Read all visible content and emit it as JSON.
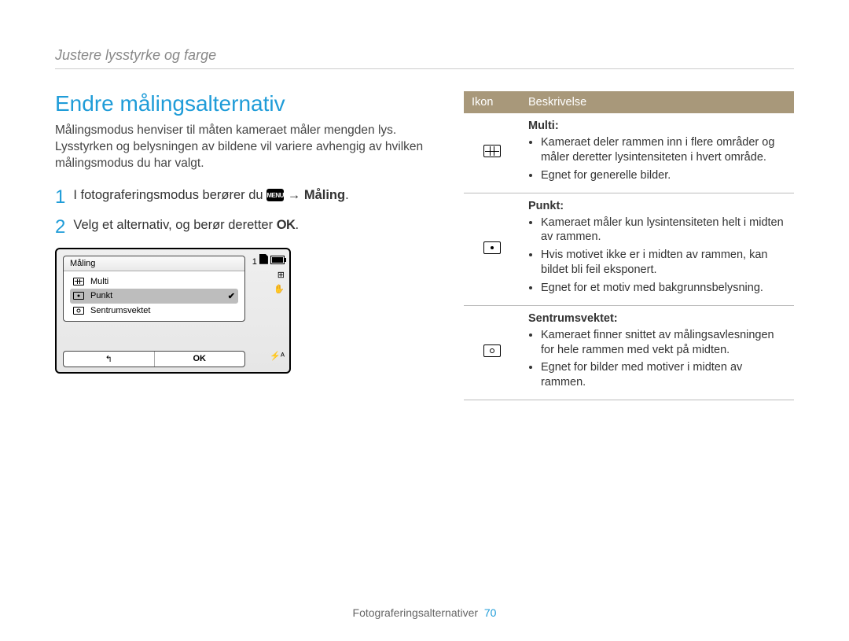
{
  "breadcrumb": "Justere lysstyrke og farge",
  "title": "Endre målingsalternativ",
  "intro": "Målingsmodus henviser til måten kameraet måler mengden lys. Lysstyrken og belysningen av bildene vil variere avhengig av hvilken målingsmodus du har valgt.",
  "steps": {
    "s1_num": "1",
    "s1_pre": "I fotograferingsmodus berører du ",
    "s1_post": " → ",
    "s1_bold": "Måling",
    "s1_end": ".",
    "s2_num": "2",
    "s2_text": "Velg et alternativ, og berør deretter ",
    "s2_ok": "OK",
    "s2_end": "."
  },
  "menu_chip": "MENU",
  "camera_ui": {
    "panel_title": "Måling",
    "items": [
      {
        "label": "Multi",
        "selected": false
      },
      {
        "label": "Punkt",
        "selected": true
      },
      {
        "label": "Sentrumsvektet",
        "selected": false
      }
    ],
    "back_glyph": "↰",
    "ok_label": "OK",
    "status_count": "1",
    "flash": "⚡ᴬ"
  },
  "table": {
    "head_icon": "Ikon",
    "head_desc": "Beskrivelse",
    "rows": [
      {
        "icon": "multi",
        "title": "Multi:",
        "bullets": [
          "Kameraet deler rammen inn i flere områder og måler deretter lysintensiteten i hvert område.",
          "Egnet for generelle bilder."
        ]
      },
      {
        "icon": "spot",
        "title": "Punkt:",
        "bullets": [
          "Kameraet måler kun lysintensiteten helt i midten av rammen.",
          "Hvis motivet ikke er i midten av rammen, kan bildet bli feil eksponert.",
          "Egnet for et motiv med bakgrunnsbelysning."
        ]
      },
      {
        "icon": "center",
        "title": "Sentrumsvektet:",
        "bullets": [
          "Kameraet finner snittet av målingsavlesningen for hele rammen med vekt på midten.",
          "Egnet for bilder med motiver i midten av rammen."
        ]
      }
    ]
  },
  "footer": {
    "section": "Fotograferingsalternativer",
    "page": "70"
  }
}
